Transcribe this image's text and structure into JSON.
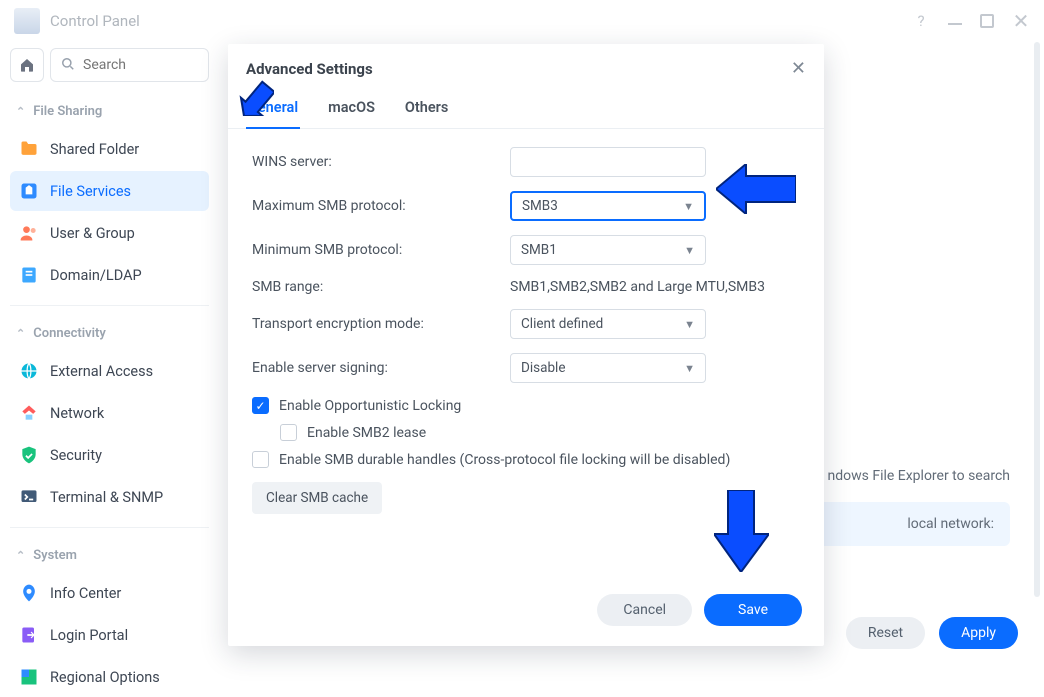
{
  "window": {
    "title": "Control Panel"
  },
  "search": {
    "placeholder": "Search"
  },
  "sidebar": {
    "sections": [
      {
        "label": "File Sharing",
        "items": [
          {
            "label": "Shared Folder"
          },
          {
            "label": "File Services"
          },
          {
            "label": "User & Group"
          },
          {
            "label": "Domain/LDAP"
          }
        ]
      },
      {
        "label": "Connectivity",
        "items": [
          {
            "label": "External Access"
          },
          {
            "label": "Network"
          },
          {
            "label": "Security"
          },
          {
            "label": "Terminal & SNMP"
          }
        ]
      },
      {
        "label": "System",
        "items": [
          {
            "label": "Info Center"
          },
          {
            "label": "Login Portal"
          },
          {
            "label": "Regional Options"
          }
        ]
      }
    ]
  },
  "content_bg": {
    "hint_tail": "ndows File Explorer to search",
    "net_label": "local network:"
  },
  "bottom": {
    "reset": "Reset",
    "apply": "Apply"
  },
  "modal": {
    "title": "Advanced Settings",
    "tabs": [
      "General",
      "macOS",
      "Others"
    ],
    "active_tab": 0,
    "fields": {
      "wins_label": "WINS server:",
      "wins_value": "",
      "max_label": "Maximum SMB protocol:",
      "max_value": "SMB3",
      "min_label": "Minimum SMB protocol:",
      "min_value": "SMB1",
      "range_label": "SMB range:",
      "range_value": "SMB1,SMB2,SMB2 and Large MTU,SMB3",
      "trans_label": "Transport encryption mode:",
      "trans_value": "Client defined",
      "sign_label": "Enable server signing:",
      "sign_value": "Disable"
    },
    "checks": {
      "opp_lock": "Enable Opportunistic Locking",
      "smb2_lease": "Enable SMB2 lease",
      "durable": "Enable SMB durable handles (Cross-protocol file locking will be disabled)"
    },
    "clear_cache": "Clear SMB cache",
    "cancel": "Cancel",
    "save": "Save"
  }
}
